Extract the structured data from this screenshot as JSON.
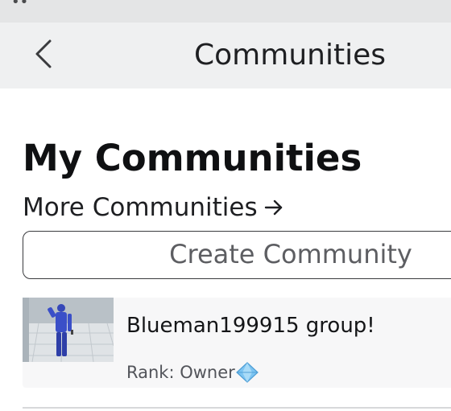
{
  "header": {
    "title": "Communities",
    "back_icon": "chevron-left-icon"
  },
  "main": {
    "heading": "My Communities",
    "more_link": "More Communities",
    "more_link_icon": "arrow-right-icon",
    "create_button": "Create Community"
  },
  "communities": [
    {
      "name": "Blueman199915 group!",
      "rank": "Rank: Owner",
      "rank_icon": "diamond-icon",
      "thumbnail_icon": "group-avatar-thumbnail"
    }
  ],
  "colors": {
    "header_bg": "#eff0f1",
    "card_bg": "#f7f7f8",
    "rank_diamond": "#6fb7ee"
  }
}
